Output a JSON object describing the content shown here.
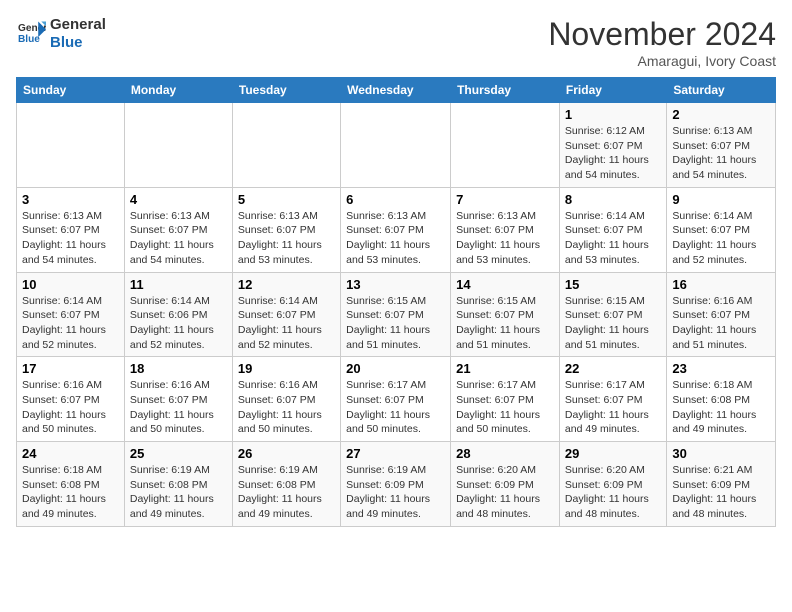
{
  "header": {
    "logo_line1": "General",
    "logo_line2": "Blue",
    "month_title": "November 2024",
    "location": "Amaragui, Ivory Coast"
  },
  "weekdays": [
    "Sunday",
    "Monday",
    "Tuesday",
    "Wednesday",
    "Thursday",
    "Friday",
    "Saturday"
  ],
  "weeks": [
    [
      {
        "day": "",
        "info": ""
      },
      {
        "day": "",
        "info": ""
      },
      {
        "day": "",
        "info": ""
      },
      {
        "day": "",
        "info": ""
      },
      {
        "day": "",
        "info": ""
      },
      {
        "day": "1",
        "info": "Sunrise: 6:12 AM\nSunset: 6:07 PM\nDaylight: 11 hours\nand 54 minutes."
      },
      {
        "day": "2",
        "info": "Sunrise: 6:13 AM\nSunset: 6:07 PM\nDaylight: 11 hours\nand 54 minutes."
      }
    ],
    [
      {
        "day": "3",
        "info": "Sunrise: 6:13 AM\nSunset: 6:07 PM\nDaylight: 11 hours\nand 54 minutes."
      },
      {
        "day": "4",
        "info": "Sunrise: 6:13 AM\nSunset: 6:07 PM\nDaylight: 11 hours\nand 54 minutes."
      },
      {
        "day": "5",
        "info": "Sunrise: 6:13 AM\nSunset: 6:07 PM\nDaylight: 11 hours\nand 53 minutes."
      },
      {
        "day": "6",
        "info": "Sunrise: 6:13 AM\nSunset: 6:07 PM\nDaylight: 11 hours\nand 53 minutes."
      },
      {
        "day": "7",
        "info": "Sunrise: 6:13 AM\nSunset: 6:07 PM\nDaylight: 11 hours\nand 53 minutes."
      },
      {
        "day": "8",
        "info": "Sunrise: 6:14 AM\nSunset: 6:07 PM\nDaylight: 11 hours\nand 53 minutes."
      },
      {
        "day": "9",
        "info": "Sunrise: 6:14 AM\nSunset: 6:07 PM\nDaylight: 11 hours\nand 52 minutes."
      }
    ],
    [
      {
        "day": "10",
        "info": "Sunrise: 6:14 AM\nSunset: 6:07 PM\nDaylight: 11 hours\nand 52 minutes."
      },
      {
        "day": "11",
        "info": "Sunrise: 6:14 AM\nSunset: 6:06 PM\nDaylight: 11 hours\nand 52 minutes."
      },
      {
        "day": "12",
        "info": "Sunrise: 6:14 AM\nSunset: 6:07 PM\nDaylight: 11 hours\nand 52 minutes."
      },
      {
        "day": "13",
        "info": "Sunrise: 6:15 AM\nSunset: 6:07 PM\nDaylight: 11 hours\nand 51 minutes."
      },
      {
        "day": "14",
        "info": "Sunrise: 6:15 AM\nSunset: 6:07 PM\nDaylight: 11 hours\nand 51 minutes."
      },
      {
        "day": "15",
        "info": "Sunrise: 6:15 AM\nSunset: 6:07 PM\nDaylight: 11 hours\nand 51 minutes."
      },
      {
        "day": "16",
        "info": "Sunrise: 6:16 AM\nSunset: 6:07 PM\nDaylight: 11 hours\nand 51 minutes."
      }
    ],
    [
      {
        "day": "17",
        "info": "Sunrise: 6:16 AM\nSunset: 6:07 PM\nDaylight: 11 hours\nand 50 minutes."
      },
      {
        "day": "18",
        "info": "Sunrise: 6:16 AM\nSunset: 6:07 PM\nDaylight: 11 hours\nand 50 minutes."
      },
      {
        "day": "19",
        "info": "Sunrise: 6:16 AM\nSunset: 6:07 PM\nDaylight: 11 hours\nand 50 minutes."
      },
      {
        "day": "20",
        "info": "Sunrise: 6:17 AM\nSunset: 6:07 PM\nDaylight: 11 hours\nand 50 minutes."
      },
      {
        "day": "21",
        "info": "Sunrise: 6:17 AM\nSunset: 6:07 PM\nDaylight: 11 hours\nand 50 minutes."
      },
      {
        "day": "22",
        "info": "Sunrise: 6:17 AM\nSunset: 6:07 PM\nDaylight: 11 hours\nand 49 minutes."
      },
      {
        "day": "23",
        "info": "Sunrise: 6:18 AM\nSunset: 6:08 PM\nDaylight: 11 hours\nand 49 minutes."
      }
    ],
    [
      {
        "day": "24",
        "info": "Sunrise: 6:18 AM\nSunset: 6:08 PM\nDaylight: 11 hours\nand 49 minutes."
      },
      {
        "day": "25",
        "info": "Sunrise: 6:19 AM\nSunset: 6:08 PM\nDaylight: 11 hours\nand 49 minutes."
      },
      {
        "day": "26",
        "info": "Sunrise: 6:19 AM\nSunset: 6:08 PM\nDaylight: 11 hours\nand 49 minutes."
      },
      {
        "day": "27",
        "info": "Sunrise: 6:19 AM\nSunset: 6:09 PM\nDaylight: 11 hours\nand 49 minutes."
      },
      {
        "day": "28",
        "info": "Sunrise: 6:20 AM\nSunset: 6:09 PM\nDaylight: 11 hours\nand 48 minutes."
      },
      {
        "day": "29",
        "info": "Sunrise: 6:20 AM\nSunset: 6:09 PM\nDaylight: 11 hours\nand 48 minutes."
      },
      {
        "day": "30",
        "info": "Sunrise: 6:21 AM\nSunset: 6:09 PM\nDaylight: 11 hours\nand 48 minutes."
      }
    ]
  ]
}
